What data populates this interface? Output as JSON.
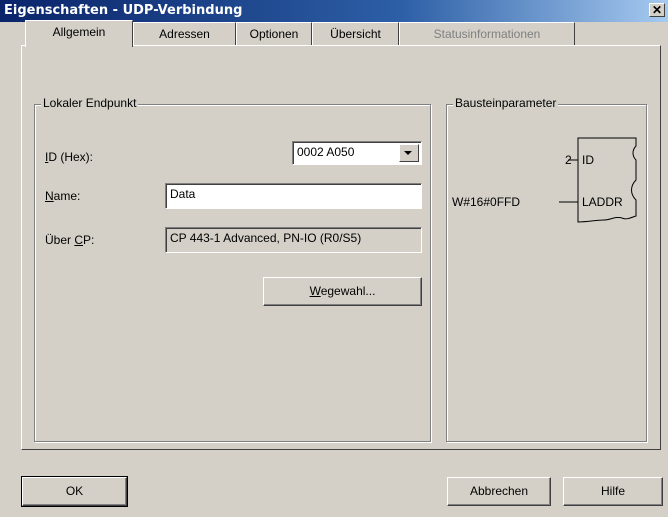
{
  "window": {
    "title": "Eigenschaften - UDP-Verbindung",
    "close_glyph": "✕"
  },
  "tabs": [
    {
      "label": "Allgemein",
      "active": true,
      "enabled": true
    },
    {
      "label": "Adressen",
      "active": false,
      "enabled": true
    },
    {
      "label": "Optionen",
      "active": false,
      "enabled": true
    },
    {
      "label": "Übersicht",
      "active": false,
      "enabled": true
    },
    {
      "label": "Statusinformationen",
      "active": false,
      "enabled": false
    }
  ],
  "local_endpoint": {
    "legend": "Lokaler Endpunkt",
    "id_label_u": "I",
    "id_label_rest": "D (Hex):",
    "id_value": "0002 A050",
    "name_label_u": "N",
    "name_label_rest": "ame:",
    "name_value": "Data",
    "cp_label_pre": "Über ",
    "cp_label_u": "C",
    "cp_label_rest": "P:",
    "cp_value": "CP 443-1 Advanced, PN-IO (R0/S5)",
    "route_button_u": "W",
    "route_button_rest": "egewahl..."
  },
  "block_params": {
    "legend": "Bausteinparameter",
    "id_input_value": "2",
    "id_pin": "ID",
    "laddr_input_value": "W#16#0FFD",
    "laddr_pin": "LADDR"
  },
  "buttons": {
    "ok": "OK",
    "cancel": "Abbrechen",
    "help": "Hilfe"
  }
}
